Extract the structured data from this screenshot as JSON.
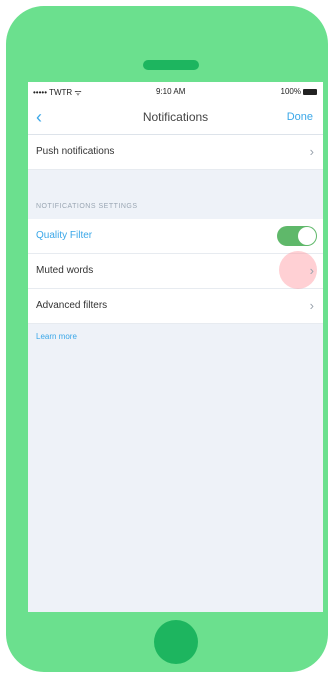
{
  "status_bar": {
    "carrier": "••••• TWTR ᯤ",
    "time": "9:10 AM",
    "battery": "100%"
  },
  "nav": {
    "title": "Notifications",
    "back_icon": "‹",
    "done_label": "Done"
  },
  "rows_top": [
    {
      "label": "Push notifications",
      "chevron": "›"
    }
  ],
  "section": {
    "header": "NOTIFICATIONS SETTINGS",
    "quality_filter": {
      "label": "Quality Filter",
      "enabled": true
    },
    "muted_words": {
      "label": "Muted words",
      "chevron": "›"
    },
    "advanced_filters": {
      "label": "Advanced filters",
      "chevron": "›"
    }
  },
  "learn_more": "Learn more",
  "colors": {
    "phone": "#6be08e",
    "accent": "#3aa7e8",
    "toggle_on": "#5fb86a"
  }
}
